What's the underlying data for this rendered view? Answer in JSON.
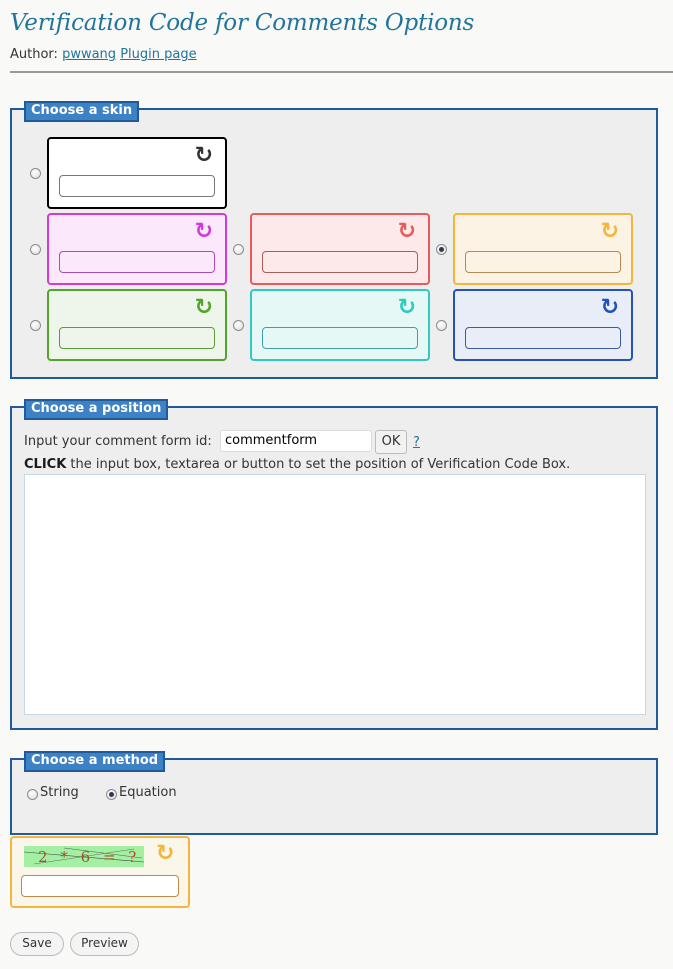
{
  "page": {
    "title": "Verification Code for Comments Options",
    "author_label": "Author:",
    "author_link": "pwwang",
    "plugin_link": "Plugin page"
  },
  "skin_section": {
    "legend": "Choose a skin",
    "selected": "orange",
    "skins": [
      {
        "name": "black",
        "color": "#000000",
        "bg": "#ffffff"
      },
      {
        "name": "magenta",
        "color": "#d33bd8",
        "bg": "#fbe8fb"
      },
      {
        "name": "red",
        "color": "#e85b5b",
        "bg": "#fde9e9"
      },
      {
        "name": "orange",
        "color": "#f5b53c",
        "bg": "#fdf3e4"
      },
      {
        "name": "green",
        "color": "#52a52a",
        "bg": "#eef5ea"
      },
      {
        "name": "teal",
        "color": "#2ec9c0",
        "bg": "#e5f8f6"
      },
      {
        "name": "blue",
        "color": "#2453b8",
        "bg": "#e8edf8"
      }
    ]
  },
  "position_section": {
    "legend": "Choose a position",
    "form_id_label": "Input your comment form id:",
    "form_id_value": "commentform",
    "ok_label": "OK",
    "help_link": "?",
    "instruction_bold": "CLICK",
    "instruction_rest": " the input box, textarea or button to set the position of Verification Code Box."
  },
  "method_section": {
    "legend": "Choose a method",
    "options": [
      "String",
      "Equation"
    ],
    "selected": "Equation"
  },
  "captcha_preview": {
    "equation_digits": [
      "2",
      "*",
      "6",
      "=",
      "?"
    ],
    "icon": "refresh-icon"
  },
  "buttons": {
    "save": "Save",
    "preview": "Preview"
  }
}
